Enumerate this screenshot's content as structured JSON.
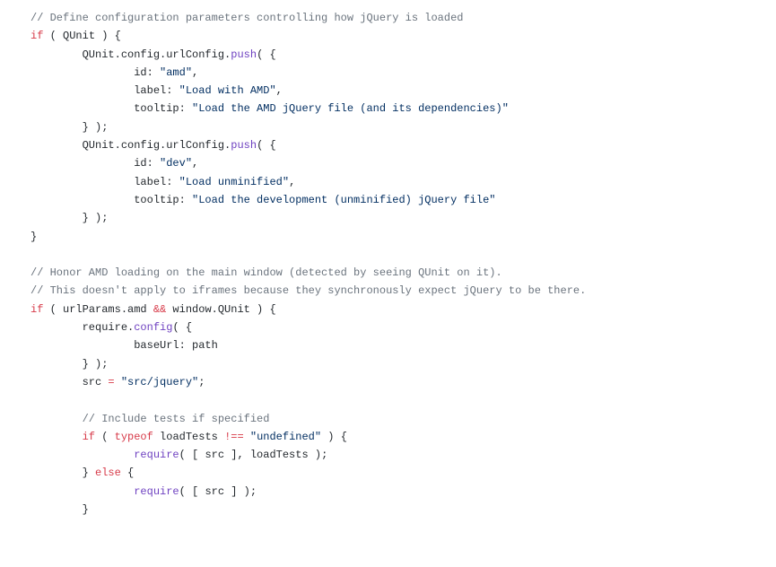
{
  "code": {
    "line01": {
      "c": "// Define configuration parameters controlling how jQuery is loaded"
    },
    "line02": {
      "k1": "if",
      "p1": " ( QUnit ) {"
    },
    "line03": {
      "p1": "        QUnit.config.urlConfig.",
      "f1": "push",
      "p2": "( {"
    },
    "line04": {
      "p1": "                id: ",
      "s1": "\"amd\"",
      "p2": ","
    },
    "line05": {
      "p1": "                label: ",
      "s1": "\"Load with AMD\"",
      "p2": ","
    },
    "line06": {
      "p1": "                tooltip: ",
      "s1": "\"Load the AMD jQuery file (and its dependencies)\""
    },
    "line07": {
      "p1": "        } );"
    },
    "line08": {
      "p1": "        QUnit.config.urlConfig.",
      "f1": "push",
      "p2": "( {"
    },
    "line09": {
      "p1": "                id: ",
      "s1": "\"dev\"",
      "p2": ","
    },
    "line10": {
      "p1": "                label: ",
      "s1": "\"Load unminified\"",
      "p2": ","
    },
    "line11": {
      "p1": "                tooltip: ",
      "s1": "\"Load the development (unminified) jQuery file\""
    },
    "line12": {
      "p1": "        } );"
    },
    "line13": {
      "p1": "}"
    },
    "line14_blank": " ",
    "line15": {
      "c": "// Honor AMD loading on the main window (detected by seeing QUnit on it)."
    },
    "line16": {
      "c": "// This doesn't apply to iframes because they synchronously expect jQuery to be there."
    },
    "line17": {
      "k1": "if",
      "p1": " ( urlParams.amd ",
      "k2": "&&",
      "p2": " window.QUnit ) {"
    },
    "line18": {
      "p1": "        require.",
      "f1": "config",
      "p2": "( {"
    },
    "line19": {
      "p1": "                baseUrl: path"
    },
    "line20": {
      "p1": "        } );"
    },
    "line21": {
      "p1": "        src ",
      "k1": "=",
      "p2": " ",
      "s1": "\"src/jquery\"",
      "p3": ";"
    },
    "line22_blank": " ",
    "line23": {
      "p1": "        ",
      "c": "// Include tests if specified"
    },
    "line24": {
      "p1": "        ",
      "k1": "if",
      "p2": " ( ",
      "k2": "typeof",
      "p3": " loadTests ",
      "k3": "!==",
      "p4": " ",
      "s1": "\"undefined\"",
      "p5": " ) {"
    },
    "line25": {
      "p1": "                ",
      "f1": "require",
      "p2": "( [ src ], loadTests );"
    },
    "line26": {
      "p1": "        } ",
      "k1": "else",
      "p2": " {"
    },
    "line27": {
      "p1": "                ",
      "f1": "require",
      "p2": "( [ src ] );"
    },
    "line28": {
      "p1": "        }"
    }
  }
}
